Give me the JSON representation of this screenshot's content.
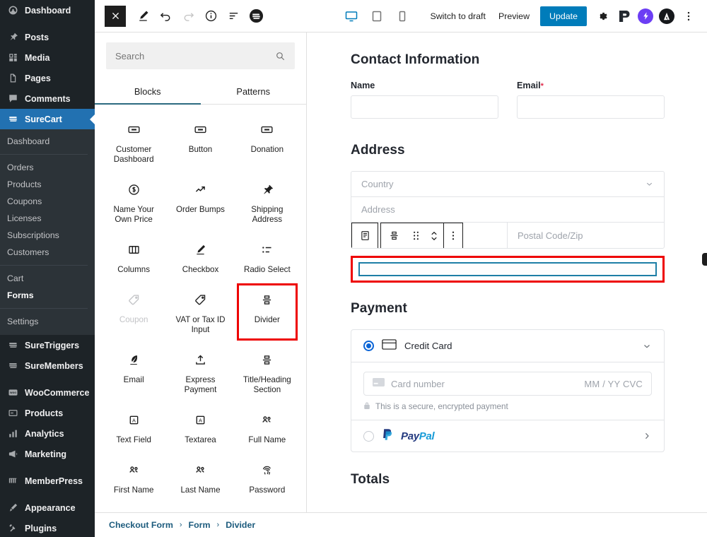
{
  "wp_sidebar": {
    "top_items": [
      {
        "label": "Dashboard",
        "icon": "dashboard-icon"
      },
      {
        "label": "Posts",
        "icon": "pin-icon"
      },
      {
        "label": "Media",
        "icon": "media-icon"
      },
      {
        "label": "Pages",
        "icon": "pages-icon"
      },
      {
        "label": "Comments",
        "icon": "comments-icon"
      }
    ],
    "active_item": {
      "label": "SureCart",
      "icon": "surecart-icon"
    },
    "submenu": [
      {
        "label": "Dashboard",
        "group": 1,
        "bold": false
      },
      {
        "label": "Orders",
        "group": 2,
        "bold": false
      },
      {
        "label": "Products",
        "group": 2,
        "bold": false
      },
      {
        "label": "Coupons",
        "group": 2,
        "bold": false
      },
      {
        "label": "Licenses",
        "group": 2,
        "bold": false
      },
      {
        "label": "Subscriptions",
        "group": 2,
        "bold": false
      },
      {
        "label": "Customers",
        "group": 2,
        "bold": false
      },
      {
        "label": "Cart",
        "group": 3,
        "bold": false
      },
      {
        "label": "Forms",
        "group": 3,
        "bold": true
      },
      {
        "label": "Settings",
        "group": 4,
        "bold": false
      }
    ],
    "bottom_items": [
      {
        "label": "SureTriggers",
        "icon": "suretriggers-icon"
      },
      {
        "label": "SureMembers",
        "icon": "suremembers-icon"
      },
      {
        "label": "WooCommerce",
        "icon": "woocommerce-icon"
      },
      {
        "label": "Products",
        "icon": "products-icon"
      },
      {
        "label": "Analytics",
        "icon": "analytics-icon"
      },
      {
        "label": "Marketing",
        "icon": "marketing-icon"
      },
      {
        "label": "MemberPress",
        "icon": "memberpress-icon"
      },
      {
        "label": "Appearance",
        "icon": "appearance-icon"
      },
      {
        "label": "Plugins",
        "icon": "plugins-icon"
      }
    ]
  },
  "topbar": {
    "close_label": "×",
    "switch_to_draft": "Switch to draft",
    "preview": "Preview",
    "update": "Update",
    "accent_color": "#007cba",
    "icons": [
      "close-icon",
      "edit-pencil-icon",
      "undo-icon",
      "redo-icon",
      "info-icon",
      "list-view-icon",
      "surecart-logo-icon",
      "desktop-view-icon",
      "tablet-view-icon",
      "mobile-view-icon",
      "settings-gear-icon",
      "presto-player-icon",
      "suretriggers-badge-icon",
      "astra-badge-icon",
      "more-options-icon"
    ]
  },
  "inserter": {
    "search_placeholder": "Search",
    "search_value": "",
    "tabs": [
      {
        "label": "Blocks",
        "active": true
      },
      {
        "label": "Patterns",
        "active": false
      }
    ],
    "blocks": [
      {
        "label": "Customer Dashboard",
        "icon": "button-block-icon",
        "disabled": false,
        "highlighted": false
      },
      {
        "label": "Button",
        "icon": "button-block-icon",
        "disabled": false,
        "highlighted": false
      },
      {
        "label": "Donation",
        "icon": "button-block-icon",
        "disabled": false,
        "highlighted": false
      },
      {
        "label": "Name Your Own Price",
        "icon": "dollar-circle-icon",
        "disabled": false,
        "highlighted": false
      },
      {
        "label": "Order Bumps",
        "icon": "trend-arrow-icon",
        "disabled": false,
        "highlighted": false
      },
      {
        "label": "Shipping Address",
        "icon": "pin-icon",
        "disabled": false,
        "highlighted": false
      },
      {
        "label": "Columns",
        "icon": "columns-icon",
        "disabled": false,
        "highlighted": false
      },
      {
        "label": "Checkbox",
        "icon": "pencil-icon",
        "disabled": false,
        "highlighted": false
      },
      {
        "label": "Radio Select",
        "icon": "radio-list-icon",
        "disabled": false,
        "highlighted": false
      },
      {
        "label": "Coupon",
        "icon": "tag-icon",
        "disabled": true,
        "highlighted": false
      },
      {
        "label": "VAT or Tax ID Input",
        "icon": "tag-icon",
        "disabled": false,
        "highlighted": false
      },
      {
        "label": "Divider",
        "icon": "divider-icon",
        "disabled": false,
        "highlighted": true
      },
      {
        "label": "Email",
        "icon": "quill-icon",
        "disabled": false,
        "highlighted": false
      },
      {
        "label": "Express Payment",
        "icon": "upload-icon",
        "disabled": false,
        "highlighted": false
      },
      {
        "label": "Title/Heading Section",
        "icon": "divider-icon",
        "disabled": false,
        "highlighted": false
      },
      {
        "label": "Text Field",
        "icon": "text-field-icon",
        "disabled": false,
        "highlighted": false
      },
      {
        "label": "Textarea",
        "icon": "text-field-icon",
        "disabled": false,
        "highlighted": false
      },
      {
        "label": "Full Name",
        "icon": "people-icon",
        "disabled": false,
        "highlighted": false
      },
      {
        "label": "First Name",
        "icon": "people-icon",
        "disabled": false,
        "highlighted": false
      },
      {
        "label": "Last Name",
        "icon": "people-icon",
        "disabled": false,
        "highlighted": false
      },
      {
        "label": "Password",
        "icon": "fingerprint-icon",
        "disabled": false,
        "highlighted": false
      }
    ]
  },
  "canvas": {
    "contact": {
      "title": "Contact Information",
      "name_label": "Name",
      "name_value": "",
      "email_label": "Email",
      "email_required_mark": "*",
      "email_value": ""
    },
    "address": {
      "title": "Address",
      "country_placeholder": "Country",
      "address_placeholder": "Address",
      "city_placeholder": "",
      "postal_placeholder": "Postal Code/Zip"
    },
    "block_toolbar": {
      "icons": [
        "block-type-icon",
        "divider-icon",
        "drag-handle-icon",
        "move-up-down-icon",
        "block-options-icon"
      ]
    },
    "selected_block": {
      "type": "Divider",
      "selection_color": "#1d7ea6",
      "annotation_color": "#ee0000"
    },
    "payment": {
      "title": "Payment",
      "credit_card_label": "Credit Card",
      "credit_card_selected": true,
      "card_number_placeholder": "Card number",
      "card_expiry_cvc": "MM / YY  CVC",
      "secure_note": "This is a secure, encrypted payment",
      "paypal_label_dark": "Pay",
      "paypal_label_light": "Pal",
      "paypal_selected": false
    },
    "totals": {
      "title": "Totals"
    }
  },
  "breadcrumb": {
    "items": [
      "Checkout Form",
      "Form",
      "Divider"
    ],
    "separator": "›",
    "color": "#1c5b7d"
  }
}
